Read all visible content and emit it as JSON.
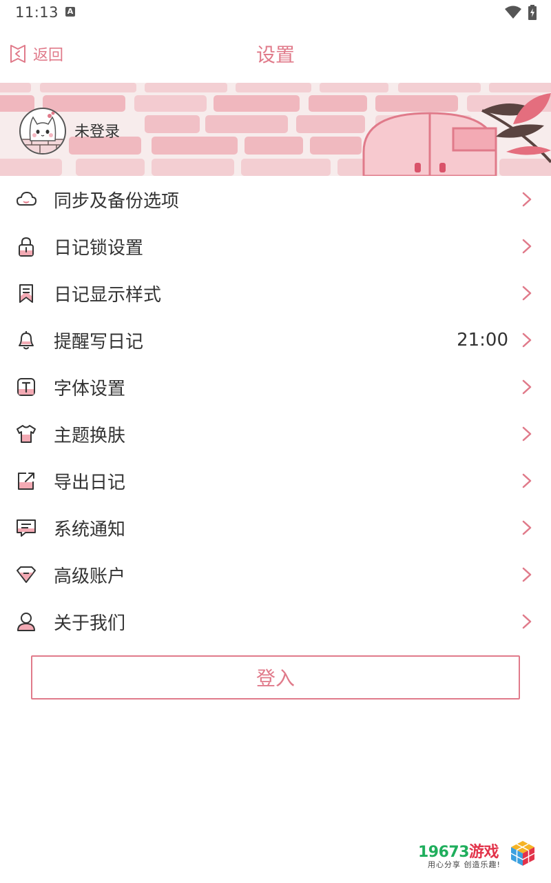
{
  "status_bar": {
    "time": "11:13",
    "notification_badge": "A"
  },
  "header": {
    "back_label": "返回",
    "title": "设置"
  },
  "profile": {
    "login_status": "未登录"
  },
  "menu": {
    "items": [
      {
        "label": "同步及备份选项",
        "icon": "cloud-icon",
        "value": ""
      },
      {
        "label": "日记锁设置",
        "icon": "lock-icon",
        "value": ""
      },
      {
        "label": "日记显示样式",
        "icon": "bookmark-icon",
        "value": ""
      },
      {
        "label": "提醒写日记",
        "icon": "bell-icon",
        "value": "21:00"
      },
      {
        "label": "字体设置",
        "icon": "font-icon",
        "value": ""
      },
      {
        "label": "主题换肤",
        "icon": "tshirt-icon",
        "value": ""
      },
      {
        "label": "导出日记",
        "icon": "export-icon",
        "value": ""
      },
      {
        "label": "系统通知",
        "icon": "message-icon",
        "value": ""
      },
      {
        "label": "高级账户",
        "icon": "diamond-icon",
        "value": ""
      },
      {
        "label": "关于我们",
        "icon": "user-icon",
        "value": ""
      }
    ]
  },
  "login_button": {
    "label": "登入"
  },
  "watermark": {
    "title_digits": "19673",
    "title_text": "游戏",
    "subtitle": "用心分享 创造乐趣!"
  },
  "colors": {
    "accent": "#e07a8a",
    "accent_light": "#f3b8c0",
    "text": "#333333"
  }
}
